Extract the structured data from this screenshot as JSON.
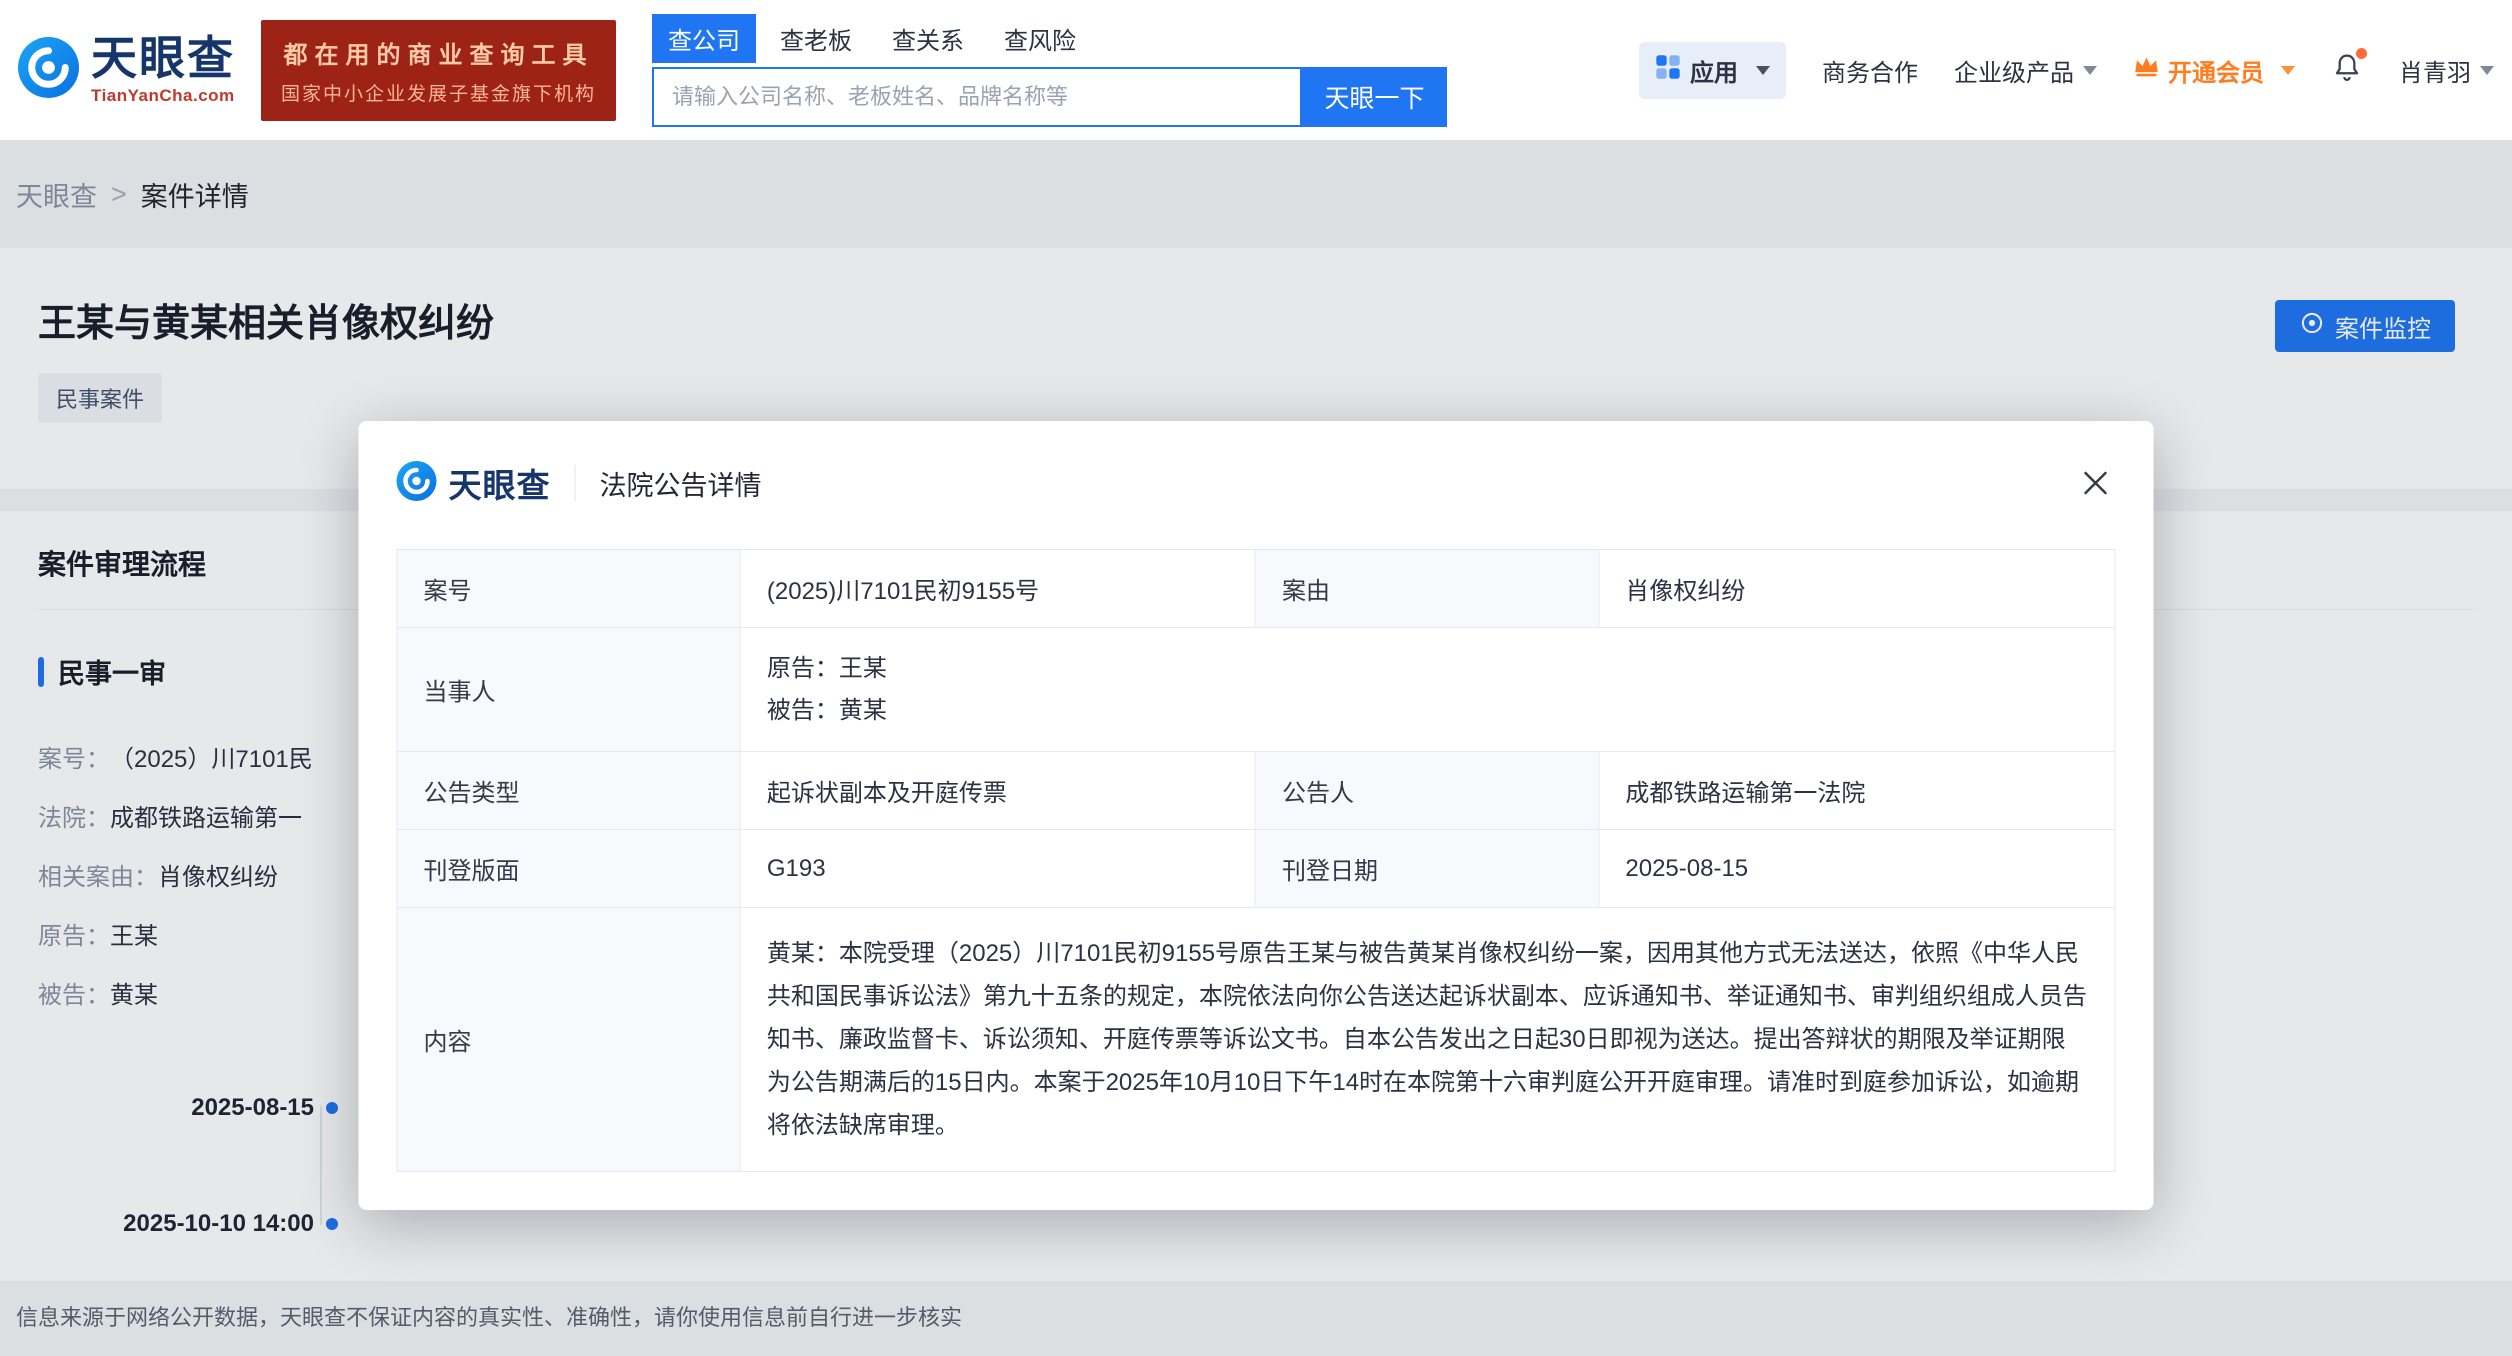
{
  "colors": {
    "brand_blue": "#2076F2",
    "vip_orange": "#FF7C1F",
    "banner_red": "#9E2317",
    "logo_navy": "#16366B",
    "logo_domain_red": "#C03A2B"
  },
  "header": {
    "logo": {
      "brand": "天眼查",
      "domain": "TianYanCha.com"
    },
    "banner": {
      "line1": "都在用的商业查询工具",
      "line2": "国家中小企业发展子基金旗下机构"
    },
    "search": {
      "tabs": [
        {
          "label": "查公司"
        },
        {
          "label": "查老板"
        },
        {
          "label": "查关系"
        },
        {
          "label": "查风险"
        }
      ],
      "placeholder": "请输入公司名称、老板姓名、品牌名称等",
      "button": "天眼一下"
    },
    "nav": {
      "apps": "应用",
      "items": [
        {
          "label": "商务合作"
        },
        {
          "label": "企业级产品"
        }
      ],
      "vip": "开通会员",
      "username": "肖青羽"
    }
  },
  "breadcrumb": {
    "home": "天眼查",
    "separator": ">",
    "current": "案件详情"
  },
  "case_header": {
    "title": "王某与黄某相关肖像权纠纷",
    "tag": "民事案件",
    "monitor_button": "案件监控"
  },
  "case_flow": {
    "section_title": "案件审理流程",
    "stage": "民事一审",
    "fields": [
      {
        "label": "案号：",
        "value": "（2025）川7101民"
      },
      {
        "label": "法院：",
        "value": "成都铁路运输第一"
      },
      {
        "label": "相关案由：",
        "value": "肖像权纠纷"
      },
      {
        "label": "原告：",
        "value": "王某"
      },
      {
        "label": "被告：",
        "value": "黄某"
      }
    ],
    "timeline": [
      {
        "date": "2025-08-15"
      },
      {
        "date": "2025-10-10 14:00"
      }
    ]
  },
  "modal": {
    "brand": "天眼查",
    "title": "法院公告详情",
    "table": {
      "row1": {
        "l1": "案号",
        "v1": "(2025)川7101民初9155号",
        "l2": "案由",
        "v2": "肖像权纠纷"
      },
      "row2": {
        "label": "当事人",
        "line1": "原告：王某",
        "line2": "被告：黄某"
      },
      "row3": {
        "l1": "公告类型",
        "v1": "起诉状副本及开庭传票",
        "l2": "公告人",
        "v2": "成都铁路运输第一法院"
      },
      "row4": {
        "l1": "刊登版面",
        "v1": "G193",
        "l2": "刊登日期",
        "v2": "2025-08-15"
      },
      "row5": {
        "label": "内容",
        "value": "黄某：本院受理（2025）川7101民初9155号原告王某与被告黄某肖像权纠纷一案，因用其他方式无法送达，依照《中华人民共和国民事诉讼法》第九十五条的规定，本院依法向你公告送达起诉状副本、应诉通知书、举证通知书、审判组织组成人员告知书、廉政监督卡、诉讼须知、开庭传票等诉讼文书。自本公告发出之日起30日即视为送达。提出答辩状的期限及举证期限为公告期满后的15日内。本案于2025年10月10日下午14时在本院第十六审判庭公开开庭审理。请准时到庭参加诉讼，如逾期将依法缺席审理。"
      }
    }
  },
  "footer": {
    "disclaimer": "信息来源于网络公开数据，天眼查不保证内容的真实性、准确性，请你使用信息前自行进一步核实"
  }
}
